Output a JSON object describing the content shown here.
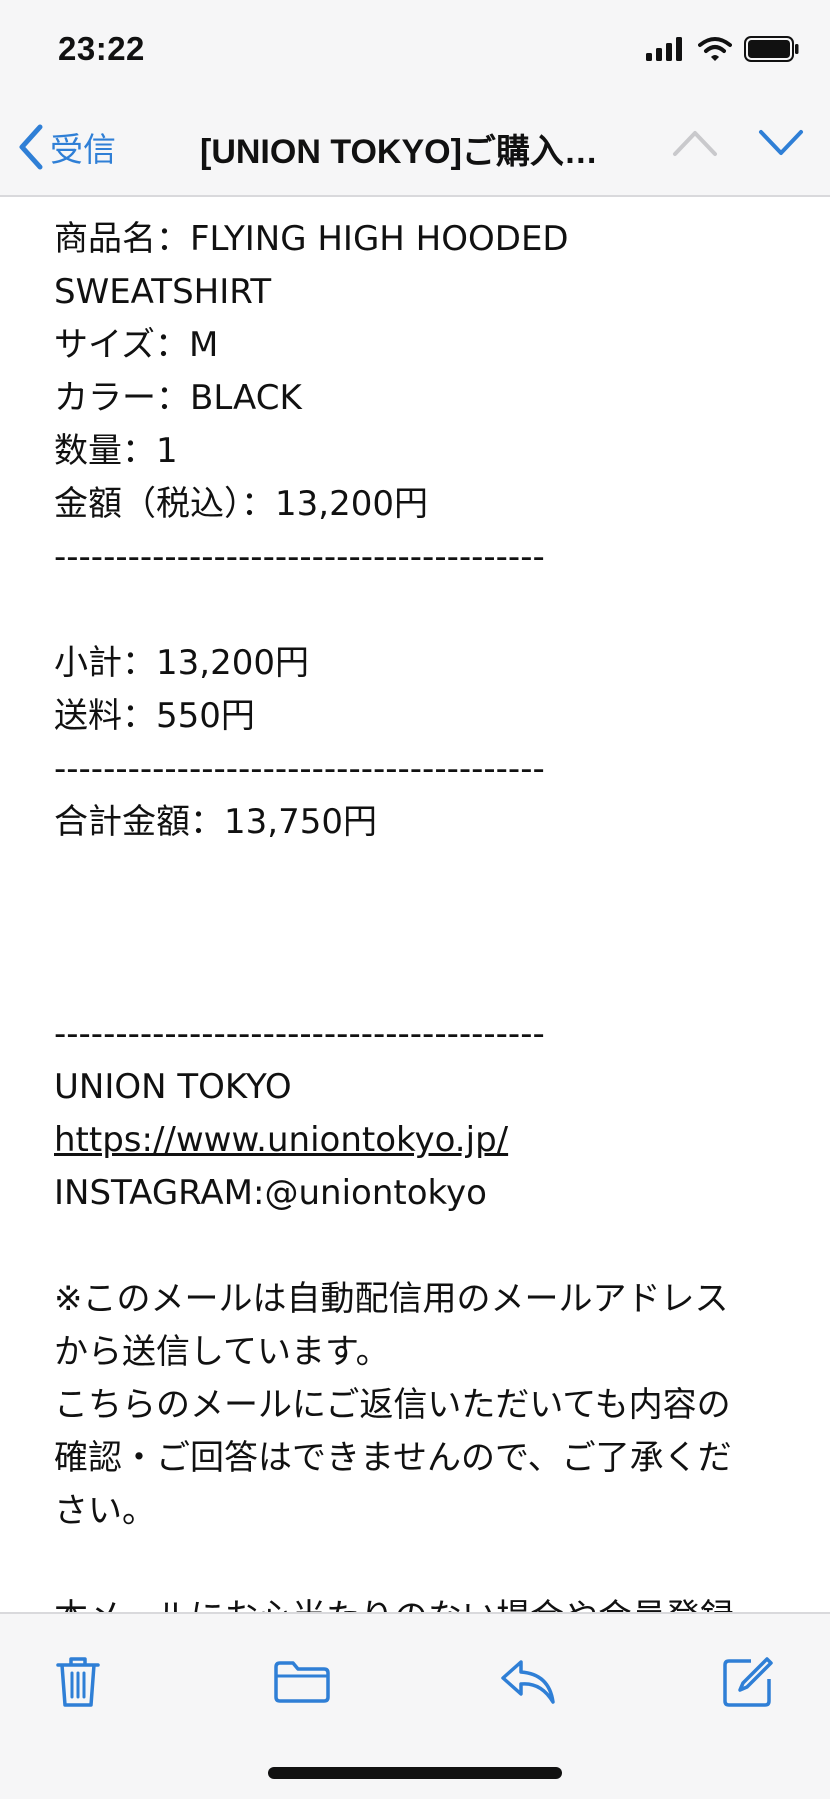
{
  "status_bar": {
    "time": "23:22"
  },
  "nav": {
    "back_label": "受信",
    "title": "[UNION TOKYO]ご購入…"
  },
  "email": {
    "lines": [
      "商品名：FLYING HIGH HOODED",
      "SWEATSHIRT",
      "サイズ：M",
      "カラー：BLACK",
      "数量：1",
      "金額（税込）：13,200円",
      "----------------------------------------",
      "小計：13,200円",
      "送料：550円",
      "----------------------------------------",
      "合計金額：13,750円",
      "----------------------------------------",
      "UNION TOKYO",
      "https://www.uniontokyo.jp/",
      "INSTAGRAM:@uniontokyo",
      "※このメールは自動配信用のメールアドレス",
      "から送信しています。",
      "こちらのメールにご返信いただいても内容の",
      "確認・ご回答はできませんので、ご了承くだ",
      "さい。",
      "本メールにお心当たりのない場合や会員登録"
    ]
  },
  "icons": {
    "accent_color": "#2f7fd6",
    "toolbar": [
      "trash-icon",
      "folder-icon",
      "reply-icon",
      "compose-icon"
    ]
  }
}
